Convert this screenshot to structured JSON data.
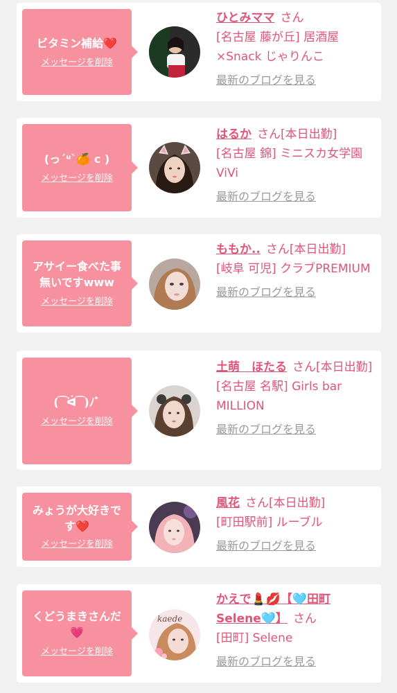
{
  "ui": {
    "delete_label": "メッセージを削除",
    "blog_label": "最新のブログを見る",
    "accent_color": "#f7909f",
    "text_color": "#e05577"
  },
  "cards": [
    {
      "message": "ビタミン補給❤️",
      "name": "ひとみママ",
      "san": "さん",
      "shop": "[名古屋 藤が丘] 居酒屋×Snack じゃりんこ"
    },
    {
      "message": "(っ´ᵘ`🍊 c )",
      "name": "はるか",
      "san": "さん[本日出勤]",
      "shop": "[名古屋 錦] ミニスカ女学園ViVi"
    },
    {
      "message": "アサイー食べた事無いですwww",
      "name": "ももか..",
      "san": "さん[本日出勤]",
      "shop": "[岐阜 可児] クラブPREMIUM"
    },
    {
      "message": "( ͡ ᐛ ͡ )ﾉﾞ",
      "name": "土萌　ほたる",
      "san": "さん[本日出勤]",
      "shop": "[名古屋 名駅] Girls bar MILLION"
    },
    {
      "message": "みょうが大好きです❤️",
      "name": "風花",
      "san": "さん[本日出勤]",
      "shop": "[町田駅前] ルーブル"
    },
    {
      "message": "くどうまきさんだ💗",
      "name": "かえで💄💋【🩵田町Selene🩵】",
      "san": "さん",
      "shop": "[田町] Selene"
    }
  ]
}
